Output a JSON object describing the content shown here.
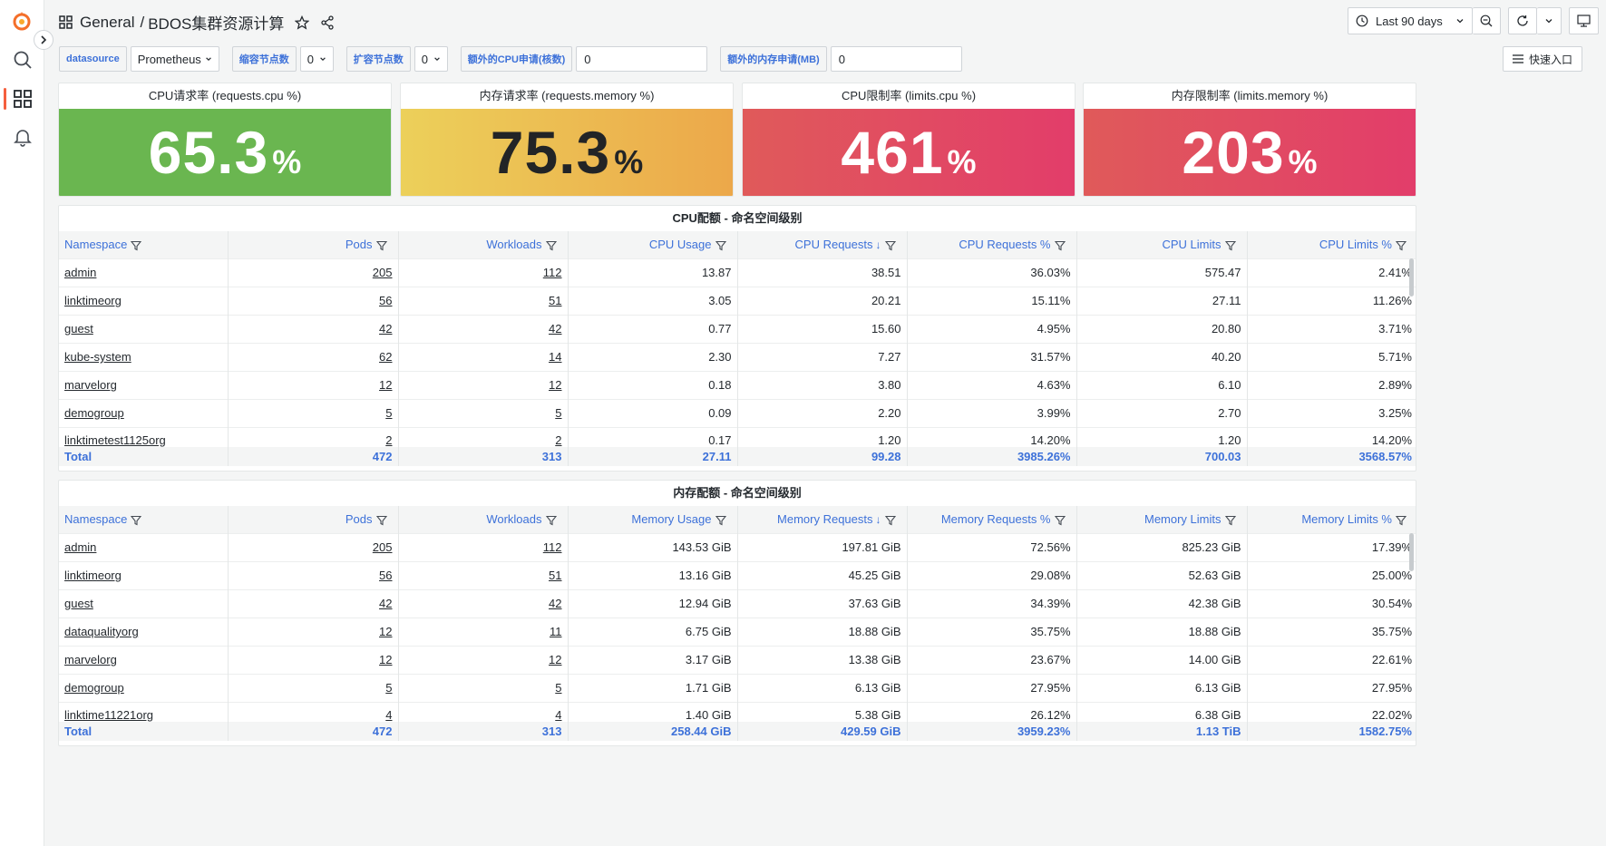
{
  "breadcrumb": {
    "folder": "General",
    "dashboard": "BDOS集群资源计算"
  },
  "time_picker": {
    "label": "Last 90 days"
  },
  "variables": {
    "datasource": {
      "label": "datasource",
      "value": "Prometheus"
    },
    "shrink": {
      "label": "缩容节点数",
      "value": "0"
    },
    "expand": {
      "label": "扩容节点数",
      "value": "0"
    },
    "extra_cpu": {
      "label": "额外的CPU申请(核数)",
      "value": "0"
    },
    "extra_mem": {
      "label": "额外的内存申请(MB)",
      "value": "0"
    }
  },
  "quick_entry": "快速入口",
  "stats": [
    {
      "title": "CPU请求率 (requests.cpu %)",
      "value": "65.3",
      "unit": "%"
    },
    {
      "title": "内存请求率 (requests.memory %)",
      "value": "75.3",
      "unit": "%"
    },
    {
      "title": "CPU限制率 (limits.cpu %)",
      "value": "461",
      "unit": "%"
    },
    {
      "title": "内存限制率 (limits.memory %)",
      "value": "203",
      "unit": "%"
    }
  ],
  "colors": {
    "green": "#6ab650",
    "yellow": "#ecd05a",
    "orange": "#eca84a",
    "red": "#e05a5a",
    "pink": "#e23d6a",
    "link_blue": "#3d71d9"
  },
  "cpu_table": {
    "title": "CPU配额 - 命名空间级别",
    "headers": [
      "Namespace",
      "Pods",
      "Workloads",
      "CPU Usage",
      "CPU Requests",
      "CPU Requests %",
      "CPU Limits",
      "CPU Limits %"
    ],
    "rows": [
      [
        "admin",
        "205",
        "112",
        "13.87",
        "38.51",
        "36.03%",
        "575.47",
        "2.41%"
      ],
      [
        "linktimeorg",
        "56",
        "51",
        "3.05",
        "20.21",
        "15.11%",
        "27.11",
        "11.26%"
      ],
      [
        "guest",
        "42",
        "42",
        "0.77",
        "15.60",
        "4.95%",
        "20.80",
        "3.71%"
      ],
      [
        "kube-system",
        "62",
        "14",
        "2.30",
        "7.27",
        "31.57%",
        "40.20",
        "5.71%"
      ],
      [
        "marvelorg",
        "12",
        "12",
        "0.18",
        "3.80",
        "4.63%",
        "6.10",
        "2.89%"
      ],
      [
        "demogroup",
        "5",
        "5",
        "0.09",
        "2.20",
        "3.99%",
        "2.70",
        "3.25%"
      ],
      [
        "linktimetest1125org",
        "2",
        "2",
        "0.17",
        "1.20",
        "14.20%",
        "1.20",
        "14.20%"
      ]
    ],
    "total": [
      "Total",
      "472",
      "313",
      "27.11",
      "99.28",
      "3985.26%",
      "700.03",
      "3568.57%"
    ]
  },
  "mem_table": {
    "title": "内存配额 - 命名空间级别",
    "headers": [
      "Namespace",
      "Pods",
      "Workloads",
      "Memory Usage",
      "Memory Requests",
      "Memory Requests %",
      "Memory Limits",
      "Memory Limits %"
    ],
    "rows": [
      [
        "admin",
        "205",
        "112",
        "143.53 GiB",
        "197.81 GiB",
        "72.56%",
        "825.23 GiB",
        "17.39%"
      ],
      [
        "linktimeorg",
        "56",
        "51",
        "13.16 GiB",
        "45.25 GiB",
        "29.08%",
        "52.63 GiB",
        "25.00%"
      ],
      [
        "guest",
        "42",
        "42",
        "12.94 GiB",
        "37.63 GiB",
        "34.39%",
        "42.38 GiB",
        "30.54%"
      ],
      [
        "dataqualityorg",
        "12",
        "11",
        "6.75 GiB",
        "18.88 GiB",
        "35.75%",
        "18.88 GiB",
        "35.75%"
      ],
      [
        "marvelorg",
        "12",
        "12",
        "3.17 GiB",
        "13.38 GiB",
        "23.67%",
        "14.00 GiB",
        "22.61%"
      ],
      [
        "demogroup",
        "5",
        "5",
        "1.71 GiB",
        "6.13 GiB",
        "27.95%",
        "6.13 GiB",
        "27.95%"
      ],
      [
        "linktime11221org",
        "4",
        "4",
        "1.40 GiB",
        "5.38 GiB",
        "26.12%",
        "6.38 GiB",
        "22.02%"
      ]
    ],
    "total": [
      "Total",
      "472",
      "313",
      "258.44 GiB",
      "429.59 GiB",
      "3959.23%",
      "1.13 TiB",
      "1582.75%"
    ]
  }
}
